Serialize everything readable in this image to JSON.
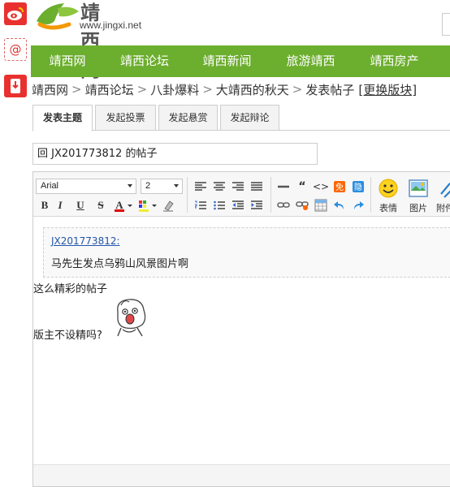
{
  "header": {
    "logo_name": "靖西网",
    "logo_url": "www.jingxi.net"
  },
  "nav": {
    "items": [
      {
        "label": "靖西网"
      },
      {
        "label": "靖西论坛"
      },
      {
        "label": "靖西新闻"
      },
      {
        "label": "旅游靖西"
      },
      {
        "label": "靖西房产"
      }
    ]
  },
  "breadcrumb": {
    "items": [
      "靖西网",
      "靖西论坛",
      "八卦爆料",
      "大靖西的秋天",
      "发表帖子"
    ],
    "separator": ">",
    "change_label": "[更换版块]"
  },
  "tabs": [
    {
      "label": "发表主题",
      "active": true
    },
    {
      "label": "发起投票",
      "active": false
    },
    {
      "label": "发起悬赏",
      "active": false
    },
    {
      "label": "发起辩论",
      "active": false
    }
  ],
  "subject": {
    "value": "回 JX201773812 的帖子"
  },
  "toolbar": {
    "font_family": "Arial",
    "font_size": "2",
    "emoji_label": "表情",
    "image_label": "图片",
    "attach_label": "附件",
    "icons": [
      "bold-icon",
      "italic-icon",
      "underline-icon",
      "strikethrough-icon",
      "font-color-icon",
      "background-color-icon",
      "clear-format-icon",
      "align-left-icon",
      "align-center-icon",
      "align-right-icon",
      "justify-icon",
      "ordered-list-icon",
      "unordered-list-icon",
      "outdent-icon",
      "indent-icon",
      "horizontal-rule-icon",
      "quote-icon",
      "code-icon",
      "free-icon",
      "hide-icon",
      "link-icon",
      "unlink-icon",
      "table-icon",
      "undo-icon",
      "redo-icon",
      "emoji-icon",
      "image-icon",
      "attachment-icon"
    ]
  },
  "editor": {
    "quote_author": "JX201773812",
    "quote_colon": ":",
    "quote_text": "马先生发点乌鸦山风景图片啊",
    "line1": "这么精彩的帖子",
    "line2": "版主不设精吗?"
  },
  "colors": {
    "nav_bg": "#6cae2e",
    "weibo_red": "#e8312f",
    "link_blue": "#2255aa"
  }
}
